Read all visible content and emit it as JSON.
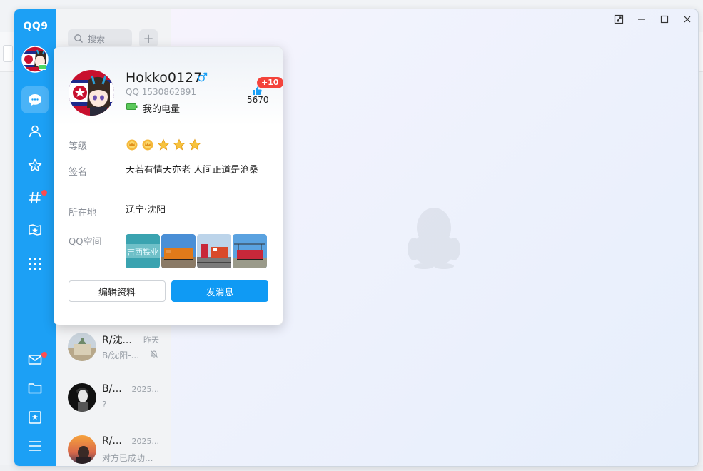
{
  "app": {
    "logo": "QQ9"
  },
  "search": {
    "placeholder": "搜索",
    "add_label": "+"
  },
  "sessions": [
    {
      "name": "R/沈...",
      "time": "昨天",
      "message": "B/沈阳-...",
      "muted": true
    },
    {
      "name": "B/...",
      "time": "2025...",
      "message": "?",
      "muted": false
    },
    {
      "name": "R/...",
      "time": "2025...",
      "message": "对方已成功...",
      "muted": false
    }
  ],
  "profile": {
    "nickname": "Hokko0127",
    "gender_symbol": "♂",
    "qq_number": "QQ 1530862891",
    "power_label": "我的电量",
    "like_badge": "+10",
    "like_count": "5670",
    "rows": {
      "level_label": "等级",
      "signature_label": "签名",
      "signature": "天若有情天亦老 人间正道是沧桑",
      "location_label": "所在地",
      "location": "辽宁·沈阳",
      "qzone_label": "QQ空间"
    },
    "level": {
      "crowns": 2,
      "stars": 3
    },
    "photo_texts": [
      "吉西铁业"
    ],
    "buttons": {
      "edit": "编辑资料",
      "send": "发消息"
    }
  },
  "colors": {
    "accent": "#1ca0f5",
    "send_button": "#0f9af4",
    "badge": "#f4433b"
  }
}
